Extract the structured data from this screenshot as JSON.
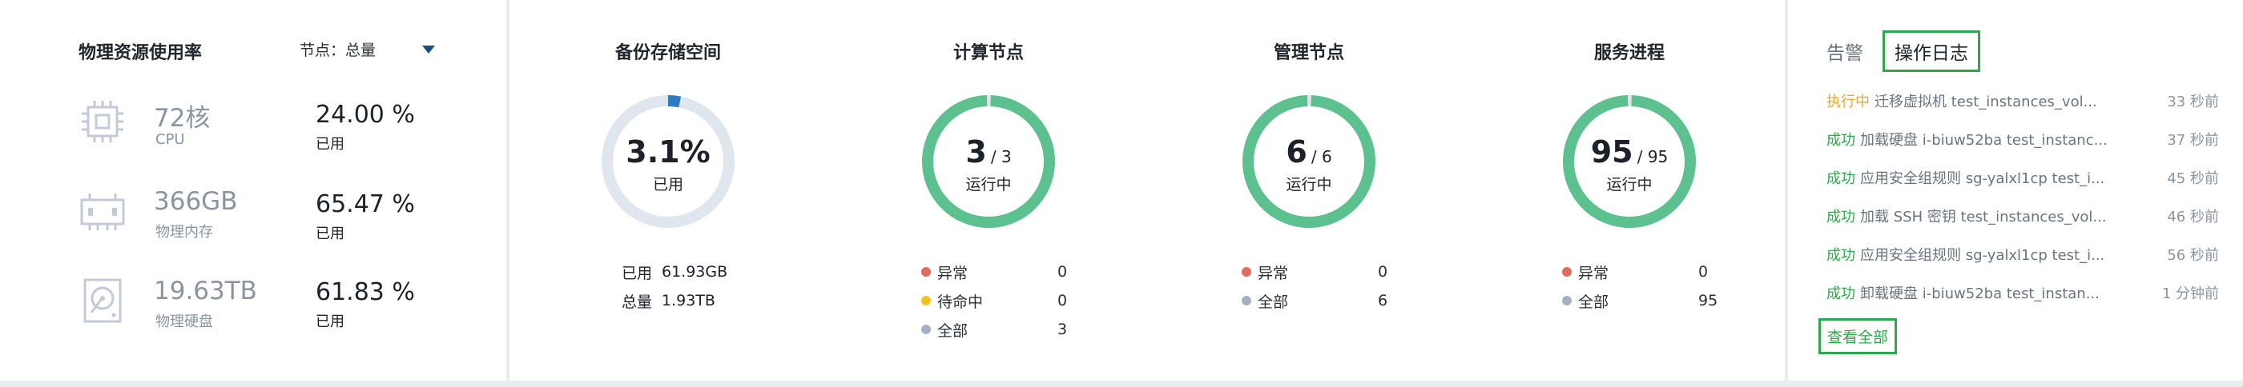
{
  "colors": {
    "green": "#5cc08f",
    "ring_bg": "#dfe6ee",
    "storage_used": "#2f7bbf",
    "danger": "#e06c5e",
    "warning": "#f2c420",
    "neutral": "#a6b0c3",
    "success_text": "#2ea84a",
    "running_text": "#e8a92e"
  },
  "resources": {
    "title": "物理资源使用率",
    "node_selector": {
      "label": "节点：总量"
    },
    "items": [
      {
        "icon": "cpu-chip-icon",
        "amount": "72核",
        "name": "CPU",
        "percent": "24.00 %",
        "percent_label": "已用"
      },
      {
        "icon": "memory-module-icon",
        "amount": "366GB",
        "name": "物理内存",
        "percent": "65.47 %",
        "percent_label": "已用"
      },
      {
        "icon": "hard-disk-icon",
        "amount": "19.63TB",
        "name": "物理硬盘",
        "percent": "61.83 %",
        "percent_label": "已用"
      }
    ]
  },
  "storage": {
    "title": "备份存储空间",
    "value": "3.1%",
    "fraction": 0.031,
    "label": "已用",
    "used_key": "已用",
    "used_value": "61.93GB",
    "total_key": "总量",
    "total_value": "1.93TB"
  },
  "compute": {
    "title": "计算节点",
    "value": "3",
    "total": "/ 3",
    "label": "运行中",
    "fraction": 1.0,
    "legend": [
      {
        "color": "danger",
        "label": "异常",
        "count": "0"
      },
      {
        "color": "warning",
        "label": "待命中",
        "count": "0"
      },
      {
        "color": "neutral",
        "label": "全部",
        "count": "3"
      }
    ]
  },
  "management": {
    "title": "管理节点",
    "value": "6",
    "total": "/ 6",
    "label": "运行中",
    "fraction": 1.0,
    "legend": [
      {
        "color": "danger",
        "label": "异常",
        "count": "0"
      },
      {
        "color": "neutral",
        "label": "全部",
        "count": "6"
      }
    ]
  },
  "services": {
    "title": "服务进程",
    "value": "95",
    "total": "/ 95",
    "label": "运行中",
    "fraction": 1.0,
    "legend": [
      {
        "color": "danger",
        "label": "异常",
        "count": "0"
      },
      {
        "color": "neutral",
        "label": "全部",
        "count": "95"
      }
    ]
  },
  "logs": {
    "tabs": [
      "告警",
      "操作日志"
    ],
    "active_tab": 1,
    "items": [
      {
        "status": "执行中",
        "status_type": "running",
        "text": "迁移虚拟机 test_instances_vol...",
        "time": "33 秒前"
      },
      {
        "status": "成功",
        "status_type": "success",
        "text": "加载硬盘 i-biuw52ba test_instanc...",
        "time": "37 秒前"
      },
      {
        "status": "成功",
        "status_type": "success",
        "text": "应用安全组规则 sg-yalxl1cp test_i...",
        "time": "45 秒前"
      },
      {
        "status": "成功",
        "status_type": "success",
        "text": "加载 SSH 密钥 test_instances_vol...",
        "time": "46 秒前"
      },
      {
        "status": "成功",
        "status_type": "success",
        "text": "应用安全组规则 sg-yalxl1cp test_i...",
        "time": "56 秒前"
      },
      {
        "status": "成功",
        "status_type": "success",
        "text": "卸载硬盘 i-biuw52ba test_instan...",
        "time": "1 分钟前"
      }
    ],
    "view_all": "查看全部"
  }
}
